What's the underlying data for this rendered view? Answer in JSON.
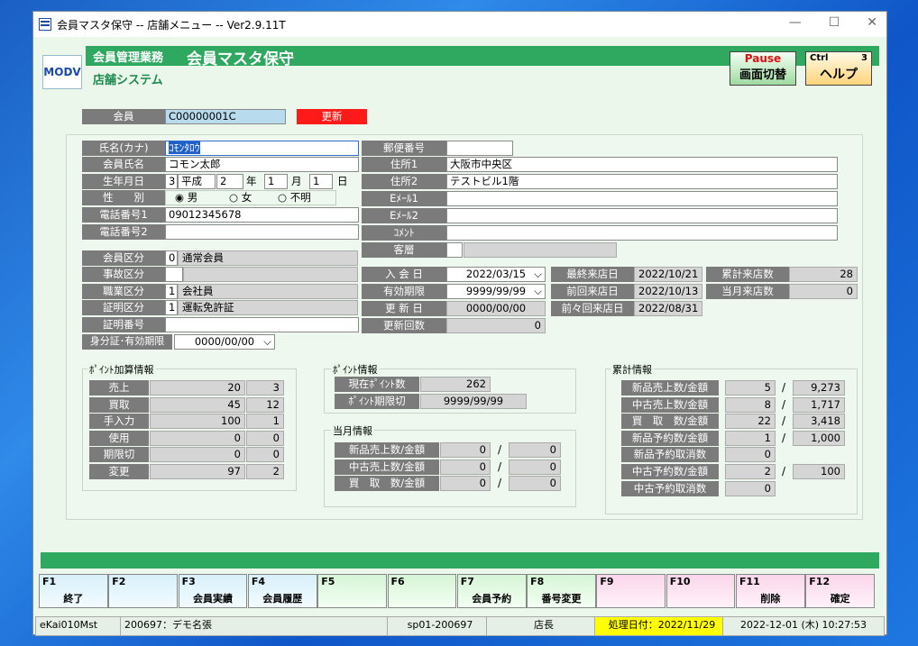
{
  "window": {
    "title": "会員マスタ保守 -- 店舗メニュー -- Ver2.9.11T"
  },
  "header": {
    "logo": "MODV",
    "mgmt": "会員管理業務",
    "title": "会員マスタ保守",
    "store": "店舗システム",
    "pause_top": "Pause",
    "pause_label": "画面切替",
    "ctrl": "Ctrl",
    "help_num": "3",
    "help_label": "ヘルプ"
  },
  "member": {
    "label": "会員",
    "id": "C00000001C",
    "update": "更新"
  },
  "left": {
    "kana_label": "氏名(カナ)",
    "kana": "ｺﾓﾝﾀﾛｳ",
    "name_label": "会員氏名",
    "name": "コモン太郎",
    "birth_label": "生年月日",
    "era_code": "3",
    "era": "平成",
    "year": "2",
    "year_unit": "年",
    "month": "1",
    "month_unit": "月",
    "day": "1",
    "day_unit": "日",
    "sex_label": "性　　別",
    "sex_options": [
      "男",
      "女",
      "不明"
    ],
    "tel1_label": "電話番号1",
    "tel1": "09012345678",
    "tel2_label": "電話番号2",
    "tel2": "",
    "cls_label": "会員区分",
    "cls_code": "0",
    "cls": "通常会員",
    "accident_label": "事故区分",
    "accident_code": "",
    "accident": "",
    "job_label": "職業区分",
    "job_code": "1",
    "job": "会社員",
    "cert_label": "証明区分",
    "cert_code": "1",
    "cert": "運転免許証",
    "certno_label": "証明番号",
    "certno": "",
    "expiry_label": "身分証･有効期限",
    "expiry": "0000/00/00"
  },
  "right": {
    "zip_label": "郵便番号",
    "zip": "",
    "addr1_label": "住所1",
    "addr1": "大阪市中央区",
    "addr2_label": "住所2",
    "addr2": "テストビル1階",
    "mail1_label": "Eﾒｰﾙ1",
    "mail1": "",
    "mail2_label": "Eﾒｰﾙ2",
    "mail2": "",
    "comment_label": "ｺﾒﾝﾄ",
    "comment": "",
    "tier_label": "客層",
    "tier_code": "",
    "tier": ""
  },
  "dates": {
    "join_label": "入 会 日",
    "join": "2022/03/15",
    "valid_label": "有効期限",
    "valid": "9999/99/99",
    "renew_label": "更 新 日",
    "renew": "0000/00/00",
    "renew_count_label": "更新回数",
    "renew_count": "0",
    "last_label": "最終来店日",
    "last": "2022/10/21",
    "prev_label": "前回来店日",
    "prev": "2022/10/13",
    "prev2_label": "前々回来店日",
    "prev2": "2022/08/31",
    "total_visits_label": "累計来店数",
    "total_visits": "28",
    "month_visits_label": "当月来店数",
    "month_visits": "0"
  },
  "points_calc": {
    "title": "ﾎﾟｲﾝﾄ加算情報",
    "rows": [
      {
        "label": "売上",
        "a": "20",
        "b": "3"
      },
      {
        "label": "買取",
        "a": "45",
        "b": "12"
      },
      {
        "label": "手入力",
        "a": "100",
        "b": "1"
      },
      {
        "label": "使用",
        "a": "0",
        "b": "0"
      },
      {
        "label": "期限切",
        "a": "0",
        "b": "0"
      },
      {
        "label": "変更",
        "a": "97",
        "b": "2"
      }
    ]
  },
  "points_info": {
    "title": "ﾎﾟｲﾝﾄ情報",
    "current_label": "現在ﾎﾟｲﾝﾄ数",
    "current": "262",
    "expire_label": "ﾎﾟｲﾝﾄ期限切",
    "expire": "9999/99/99"
  },
  "monthly": {
    "title": "当月情報",
    "rows": [
      {
        "label": "新品売上数/金額",
        "a": "0",
        "b": "0"
      },
      {
        "label": "中古売上数/金額",
        "a": "0",
        "b": "0"
      },
      {
        "label": "買　取　数/金額",
        "a": "0",
        "b": "0"
      }
    ]
  },
  "cumulative": {
    "title": "累計情報",
    "rows": [
      {
        "label": "新品売上数/金額",
        "a": "5",
        "b": "9,273"
      },
      {
        "label": "中古売上数/金額",
        "a": "8",
        "b": "1,717"
      },
      {
        "label": "買　取　数/金額",
        "a": "22",
        "b": "3,418"
      },
      {
        "label": "新品予約数/金額",
        "a": "1",
        "b": "1,000"
      },
      {
        "label": "新品予約取消数",
        "a": "0",
        "b": null
      },
      {
        "label": "中古予約数/金額",
        "a": "2",
        "b": "100"
      },
      {
        "label": "中古予約取消数",
        "a": "0",
        "b": null
      }
    ]
  },
  "slash": "/",
  "fkeys": [
    {
      "n": "F1",
      "t": "終了"
    },
    {
      "n": "F2",
      "t": ""
    },
    {
      "n": "F3",
      "t": "会員実績"
    },
    {
      "n": "F4",
      "t": "会員履歴"
    },
    {
      "n": "F5",
      "t": ""
    },
    {
      "n": "F6",
      "t": ""
    },
    {
      "n": "F7",
      "t": "会員予約"
    },
    {
      "n": "F8",
      "t": "番号変更"
    },
    {
      "n": "F9",
      "t": ""
    },
    {
      "n": "F10",
      "t": ""
    },
    {
      "n": "F11",
      "t": "削除"
    },
    {
      "n": "F12",
      "t": "確定"
    }
  ],
  "status": {
    "screen": "eKai010Mst",
    "user": "200697：デモ名張",
    "terminal": "sp01-200697",
    "role": "店長",
    "proc_date": "処理日付：2022/11/29",
    "datetime": "2022-12-01 (木) 10:27:53"
  },
  "colors": {
    "accent_green": "#2fa860",
    "update_red": "#ff1a1a",
    "id_blue": "#b8dcee",
    "label_gray": "#7b7b7b",
    "proc_yellow": "#ffff00"
  }
}
